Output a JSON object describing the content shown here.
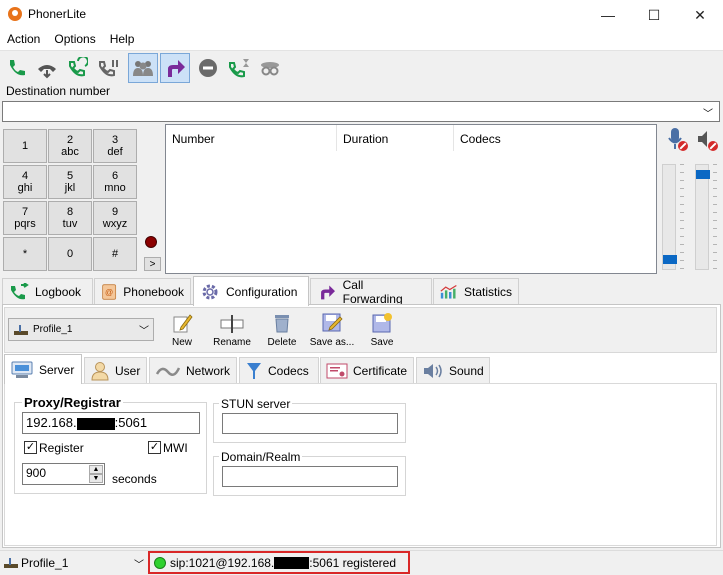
{
  "app": {
    "title": "PhonerLite"
  },
  "window_controls": {
    "minimize": "—",
    "maximize": "☐",
    "close": "✕"
  },
  "menu": [
    "Action",
    "Options",
    "Help"
  ],
  "destination": {
    "label": "Destination number",
    "value": ""
  },
  "keypad": [
    {
      "digit": "1",
      "letters": ""
    },
    {
      "digit": "2",
      "letters": "abc"
    },
    {
      "digit": "3",
      "letters": "def"
    },
    {
      "digit": "4",
      "letters": "ghi"
    },
    {
      "digit": "5",
      "letters": "jkl"
    },
    {
      "digit": "6",
      "letters": "mno"
    },
    {
      "digit": "7",
      "letters": "pqrs"
    },
    {
      "digit": "8",
      "letters": "tuv"
    },
    {
      "digit": "9",
      "letters": "wxyz"
    },
    {
      "digit": "*",
      "letters": ""
    },
    {
      "digit": "0",
      "letters": ""
    },
    {
      "digit": "#",
      "letters": ""
    }
  ],
  "expand_label": ">",
  "calls_table": {
    "columns": [
      "Number",
      "Duration",
      "Codecs"
    ]
  },
  "volume": {
    "microphone_level": 0.05,
    "speaker_level": 0.95
  },
  "main_tabs": [
    {
      "label": "Logbook",
      "icon": "logbook-icon"
    },
    {
      "label": "Phonebook",
      "icon": "phonebook-icon"
    },
    {
      "label": "Configuration",
      "icon": "gear-icon",
      "active": true
    },
    {
      "label": "Call Forwarding",
      "icon": "forward-arrow-icon"
    },
    {
      "label": "Statistics",
      "icon": "chart-icon"
    }
  ],
  "profile": {
    "selected": "Profile_1",
    "buttons": [
      "New",
      "Rename",
      "Delete",
      "Save as...",
      "Save"
    ]
  },
  "sub_tabs": [
    {
      "label": "Server",
      "active": true
    },
    {
      "label": "User"
    },
    {
      "label": "Network"
    },
    {
      "label": "Codecs"
    },
    {
      "label": "Certificate"
    },
    {
      "label": "Sound"
    }
  ],
  "server": {
    "proxy_label": "Proxy/Registrar",
    "proxy_prefix": "192.168.",
    "proxy_suffix": ":5061",
    "register_label": "Register",
    "register_checked": true,
    "mwi_label": "MWI",
    "mwi_checked": true,
    "interval": "900",
    "seconds_label": "seconds",
    "stun_label": "STUN server",
    "stun_value": "",
    "domain_label": "Domain/Realm",
    "domain_value": ""
  },
  "status": {
    "profile": "Profile_1",
    "text_prefix": "sip:1021@192.168.",
    "text_suffix": ":5061 registered",
    "led_color": "#2fd12f",
    "highlight_color": "#d92727"
  },
  "colors": {
    "accent": "#0b68c4",
    "call_green": "#1a9a4a",
    "forward_purple": "#7a2a9a"
  }
}
